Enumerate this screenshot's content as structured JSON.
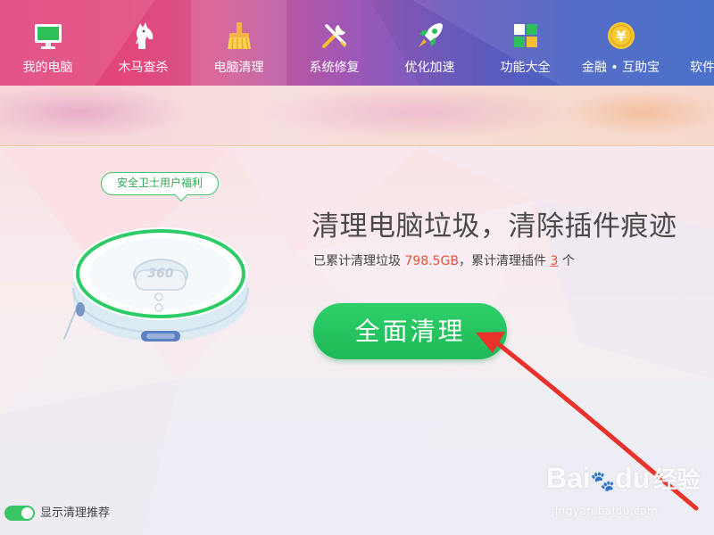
{
  "nav": {
    "items": [
      {
        "label": "我的电脑",
        "icon": "monitor-icon"
      },
      {
        "label": "木马查杀",
        "icon": "horse-icon"
      },
      {
        "label": "电脑清理",
        "icon": "broom-icon"
      },
      {
        "label": "系统修复",
        "icon": "wrench-screwdriver-icon"
      },
      {
        "label": "优化加速",
        "icon": "rocket-icon"
      },
      {
        "label": "功能大全",
        "icon": "grid-icon"
      },
      {
        "label": "金融 • 互助宝",
        "icon": "yuan-coin-icon"
      },
      {
        "label": "软件",
        "icon": "software-icon"
      }
    ],
    "active_index": 2
  },
  "promo": {
    "bubble": "安全卫士用户福利",
    "robot_brand": "360"
  },
  "main": {
    "headline": "清理电脑垃圾，清除插件痕迹",
    "stats_prefix": "已累计清理垃圾",
    "stats_size": "798.5GB",
    "stats_middle": "，累计清理插件",
    "stats_count": "3",
    "stats_suffix": "个",
    "clean_button": "全面清理"
  },
  "footer": {
    "toggle_label": "显示清理推荐",
    "toggle_on": true
  },
  "watermark": {
    "main": "Bai",
    "paw": "du",
    "jingyan": "经验",
    "sub": "jingyan.baidu.com"
  },
  "colors": {
    "accent_green": "#2ed06a",
    "highlight_red": "#e8503a",
    "arrow_red": "#e8322a"
  }
}
